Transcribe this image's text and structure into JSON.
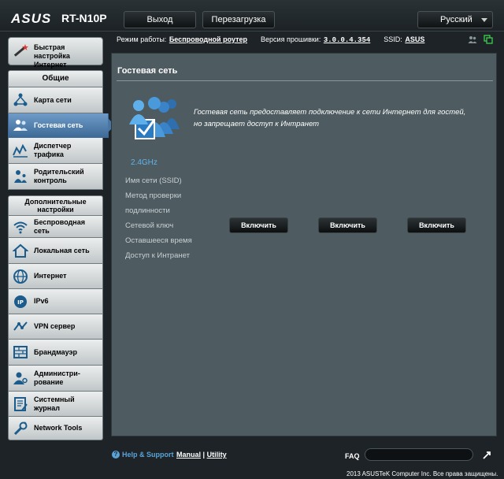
{
  "header": {
    "logo": "ASUS",
    "model": "RT-N10P",
    "logout_label": "Выход",
    "reboot_label": "Перезагрузка",
    "language": "Русский"
  },
  "status": {
    "mode_label": "Режим работы:",
    "mode_value": "Беспроводной роутер",
    "fw_label": "Версия прошивки:",
    "fw_value": "3.0.0.4.354",
    "ssid_label": "SSID:",
    "ssid_value": "ASUS"
  },
  "sidebar": {
    "quick_setup": "Быстрая настройка Интернет",
    "general_header": "Общие",
    "general_items": [
      {
        "label": "Карта сети",
        "icon": "network-map-icon"
      },
      {
        "label": "Гостевая сеть",
        "icon": "guest-network-icon",
        "active": true
      },
      {
        "label": "Диспетчер трафика",
        "icon": "traffic-manager-icon"
      },
      {
        "label": "Родительский контроль",
        "icon": "parental-control-icon"
      }
    ],
    "advanced_header": "Дополнительные настройки",
    "advanced_items": [
      {
        "label": "Беспроводная сеть",
        "icon": "wireless-icon"
      },
      {
        "label": "Локальная сеть",
        "icon": "lan-icon"
      },
      {
        "label": "Интернет",
        "icon": "globe-icon"
      },
      {
        "label": "IPv6",
        "icon": "ipv6-icon"
      },
      {
        "label": "VPN сервер",
        "icon": "vpn-icon"
      },
      {
        "label": "Брандмауэр",
        "icon": "firewall-icon"
      },
      {
        "label": "Администри-рование",
        "icon": "admin-icon"
      },
      {
        "label": "Системный журнал",
        "icon": "system-log-icon"
      },
      {
        "label": "Network Tools",
        "icon": "network-tools-icon"
      }
    ]
  },
  "main": {
    "title": "Гостевая сеть",
    "description_line1": "Гостевая сеть предоставляет подключение к сети Интернет для гостей,",
    "description_line2": "но запрещает доступ к Интранет",
    "band": "2.4GHz",
    "labels": {
      "ssid": "Имя сети (SSID)",
      "auth1": "Метод проверки",
      "auth2": "подлинности",
      "key": "Сетевой ключ",
      "time_left": "Оставшееся время",
      "intranet": "Доступ к Интранет"
    },
    "enable_label": "Включить"
  },
  "footer": {
    "help": "Help & Support",
    "manual": "Manual",
    "separator": "|",
    "utility": "Utility",
    "faq": "FAQ",
    "copyright": "2013  ASUSTeK Computer Inc. Все права защищены."
  },
  "colors": {
    "background": "#1d2327",
    "panel": "#4e5b61",
    "accent_blue": "#5aa3d8",
    "active_nav": "#4a76a4"
  }
}
